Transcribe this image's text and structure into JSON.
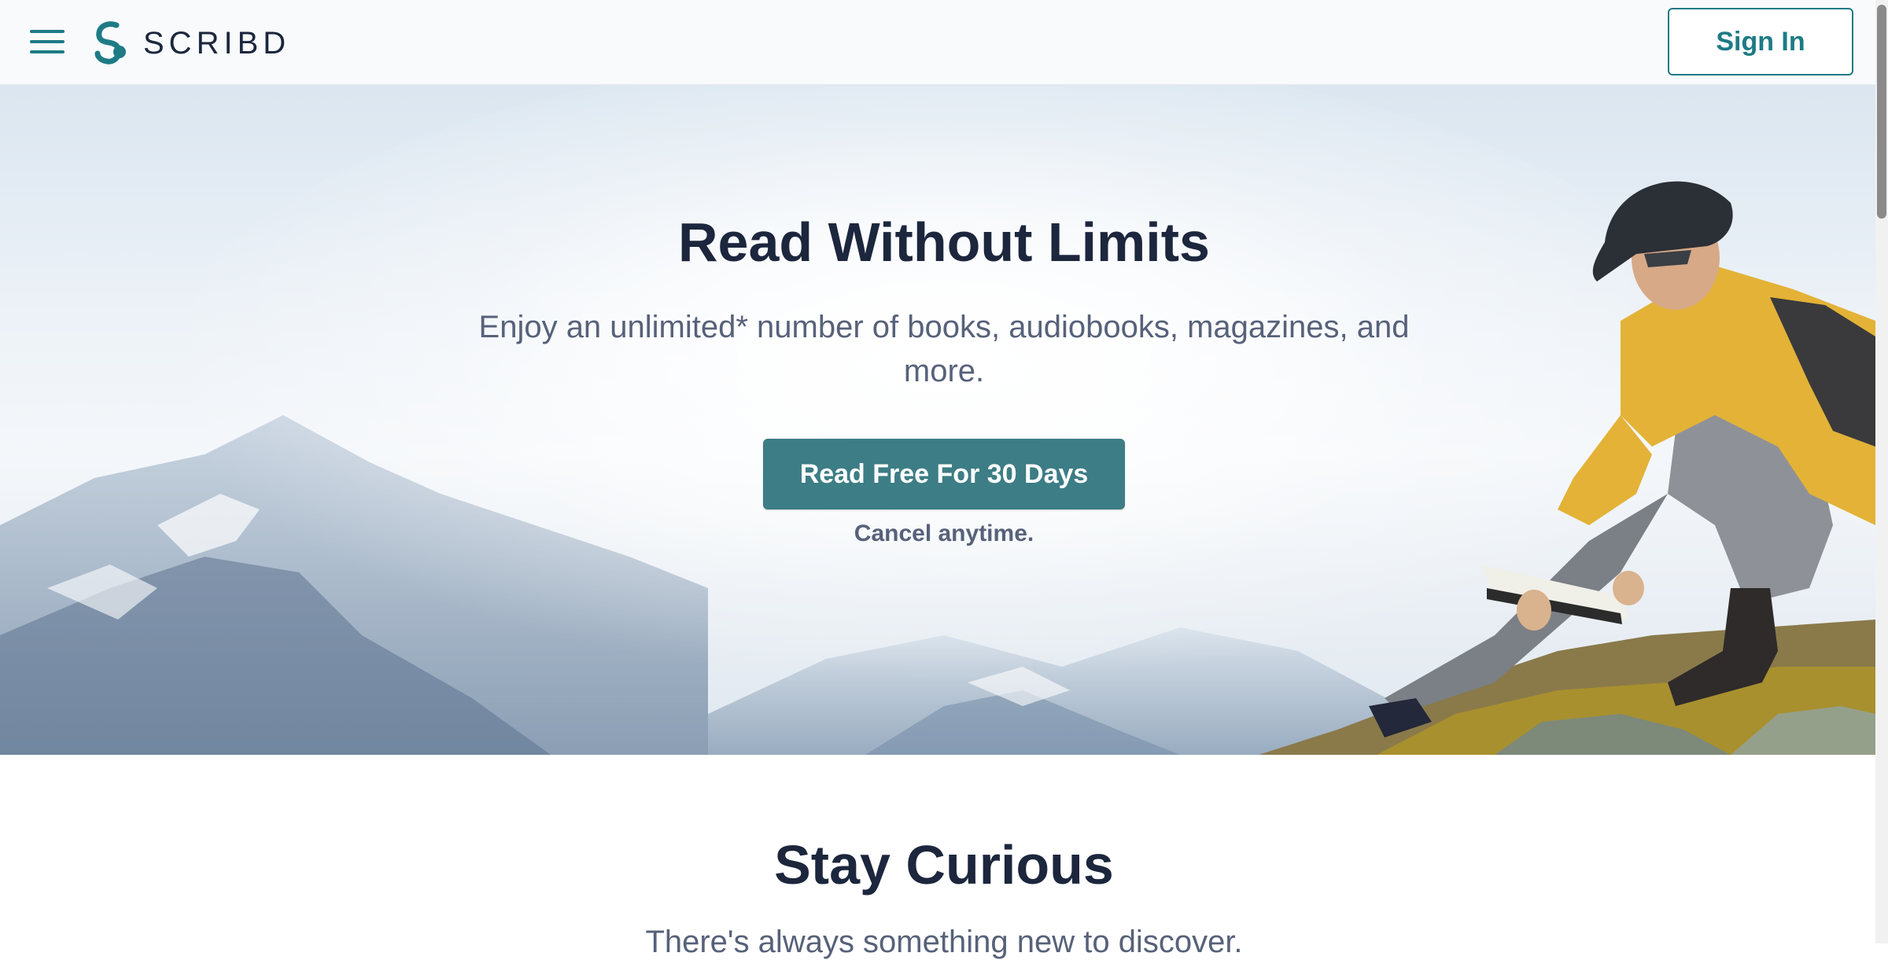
{
  "header": {
    "brand": "SCRIBD",
    "sign_in_label": "Sign In"
  },
  "icons": {
    "menu": "hamburger-icon",
    "logo": "scribd-logo-icon"
  },
  "hero": {
    "title": "Read Without Limits",
    "subtitle": "Enjoy an unlimited* number of books, audiobooks, magazines, and more.",
    "cta_label": "Read Free For 30 Days",
    "cancel_note": "Cancel anytime."
  },
  "section": {
    "title": "Stay Curious",
    "subtitle": "There's always something new to discover."
  },
  "colors": {
    "accent": "#1e7b85",
    "cta": "#3d7d85",
    "heading": "#1c263d",
    "body": "#57617a"
  }
}
